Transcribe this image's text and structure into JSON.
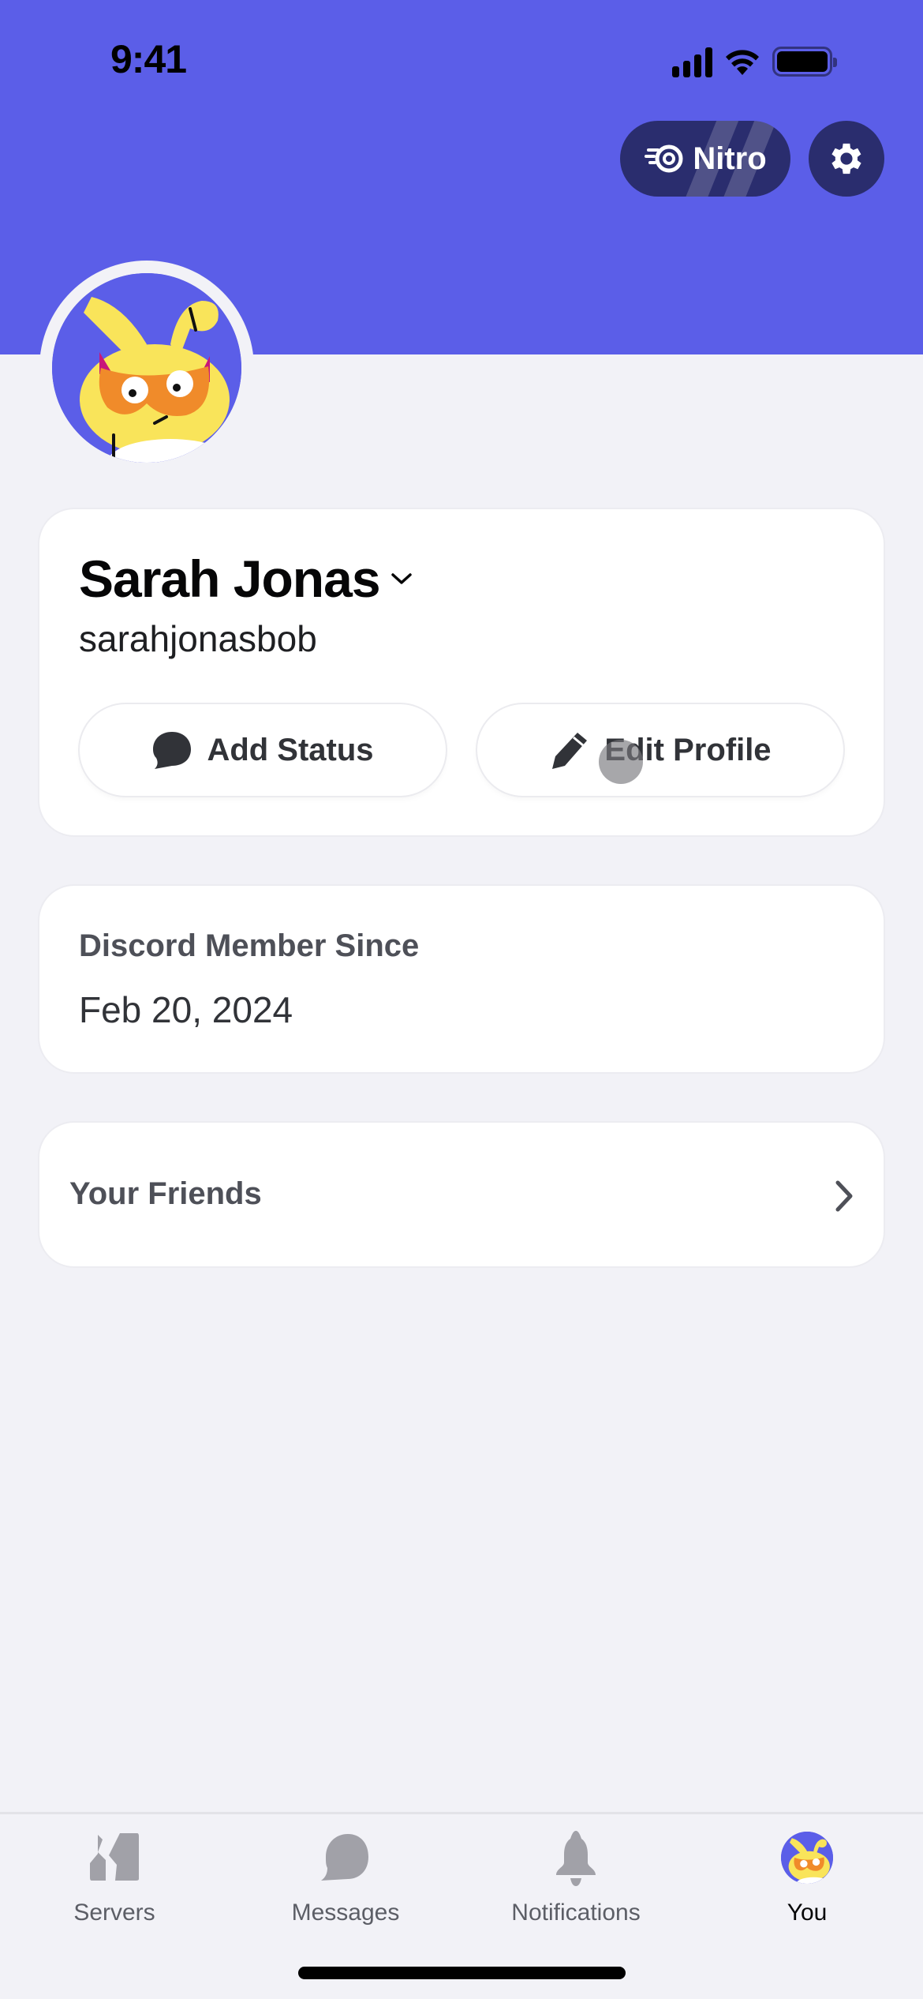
{
  "status_bar": {
    "time": "9:41",
    "signal_icon": "cellular-signal-icon",
    "wifi_icon": "wifi-icon",
    "battery_icon": "battery-icon"
  },
  "header": {
    "nitro_label": "Nitro",
    "nitro_icon": "nitro-icon",
    "settings_icon": "gear-icon",
    "banner_color": "#5b5ee8"
  },
  "profile": {
    "avatar_icon": "bunny-avatar",
    "display_name": "Sarah Jonas",
    "username": "sarahjonasbob",
    "add_status_label": "Add Status",
    "edit_profile_label": "Edit Profile"
  },
  "member_since": {
    "label": "Discord Member Since",
    "date": "Feb 20, 2024"
  },
  "friends": {
    "label": "Your Friends"
  },
  "tabbar": {
    "items": [
      {
        "label": "Servers",
        "icon": "servers-icon",
        "active": false
      },
      {
        "label": "Messages",
        "icon": "messages-icon",
        "active": false
      },
      {
        "label": "Notifications",
        "icon": "bell-icon",
        "active": false
      },
      {
        "label": "You",
        "icon": "avatar",
        "active": true
      }
    ]
  },
  "colors": {
    "accent": "#5b5ee8",
    "nitro_pill": "#2a2d6e",
    "background": "#f2f2f7",
    "inactive_icon": "#a1a1a8"
  }
}
